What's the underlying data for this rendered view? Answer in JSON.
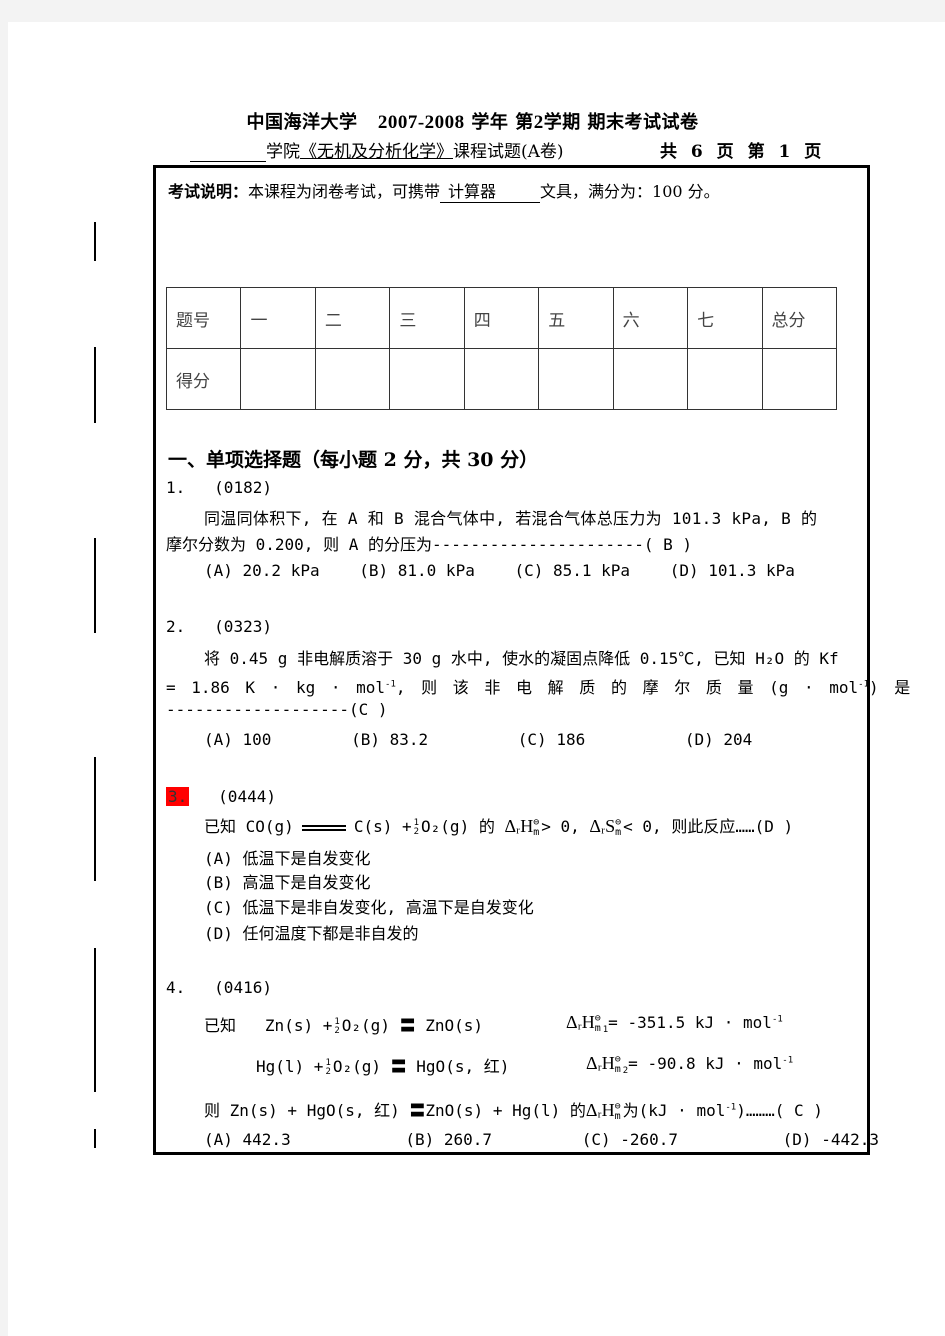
{
  "header": {
    "title_school": "中国海洋大学",
    "title_years": "2007-2008",
    "title_rest_1": "学年 第",
    "title_term": "2",
    "title_rest_2": "学期 期末考试试卷",
    "subtitle_college": "学院",
    "subtitle_course": "《无机及分析化学》",
    "subtitle_rest": "课程试题(A卷)",
    "pages_text": "共 6 页 第 1 页"
  },
  "instructions": {
    "label": "考试说明：",
    "text_before": "本课程为闭卷考试，可携带",
    "tool": "计算器",
    "text_after": "文具，满分为：100 分。"
  },
  "score_table": {
    "header_row": [
      "题号",
      "一",
      "二",
      "三",
      "四",
      "五",
      "六",
      "七",
      "总分"
    ],
    "score_row": [
      "得分",
      "",
      "",
      "",
      "",
      "",
      "",
      "",
      ""
    ]
  },
  "section": {
    "title": "一、单项选择题（每小题 2 分，共 30 分）"
  },
  "questions": [
    {
      "number": "1.",
      "code": "(0182)",
      "stem_line1": "同温同体积下, 在 A 和 B 混合气体中, 若混合气体总压力为 101.3 kPa, B 的",
      "stem_line2": "摩尔分数为 0.200, 则 A 的分压为----------------------( B  )",
      "options": [
        "(A) 20.2 kPa",
        "(B) 81.0 kPa",
        "(C) 85.1 kPa",
        "(D) 101.3 kPa"
      ],
      "answer": "B"
    },
    {
      "number": "2.",
      "code": "(0323)",
      "stem_line1": "将 0.45 g 非电解质溶于 30 g 水中, 使水的凝固点降低 0.15℃, 已知 H₂O 的 Kf",
      "stem_line2_a": "= 1.86 K · kg · mol",
      "stem_line2_b": ", 则 该 非 电 解 质 的 摩 尔 质 量 (g · mol",
      "stem_line2_c": ") 是",
      "stem_line3": "-------------------(C   )",
      "sup": "-1",
      "options": [
        "(A)  100",
        "(B)  83.2",
        "(C)  186",
        "(D)  204"
      ],
      "answer": "C"
    },
    {
      "number": "3.",
      "number_highlight": "#ff0000",
      "code": "(0444)",
      "stem_prefix": "已知 CO(g)",
      "stem_products": "C(s) +",
      "stem_o2": "O₂(g)  的",
      "delta_H": "ΔᵣH",
      "cond1": "> 0,",
      "delta_S": "ΔᵣS",
      "cond2": "< 0,  则此反应……(D  )",
      "frac_num": "1",
      "frac_den": "2",
      "std_symbol": "⊖",
      "sub_m": "m",
      "options": [
        "(A) 低温下是自发变化",
        "(B) 高温下是自发变化",
        "(C) 低温下是非自发变化, 高温下是自发变化",
        "(D) 任何温度下都是非自发的"
      ],
      "answer": "D"
    },
    {
      "number": "4.",
      "code": "(0416)",
      "given_label": "已知",
      "eq1_left": "Zn(s) +",
      "eq1_right": "O₂(g)  〓 ZnO(s)",
      "eq1_value": "= -351.5 kJ · mol",
      "eq1_index": "1",
      "eq2_left": "Hg(l) +",
      "eq2_right": "O₂(g)  〓 HgO(s, 红)",
      "eq2_value": "= -90.8 kJ · mol",
      "eq2_index": "2",
      "target_prefix": "则 Zn(s) + HgO(s, 红) 〓ZnO(s) + Hg(l) 的",
      "target_suffix": "为(kJ · mol",
      "target_end": ")………( C  )",
      "sup": "-1",
      "options": [
        "(A) 442.3",
        "(B) 260.7",
        "(C) -260.7",
        "(D) -442.3"
      ],
      "answer": "C"
    }
  ]
}
